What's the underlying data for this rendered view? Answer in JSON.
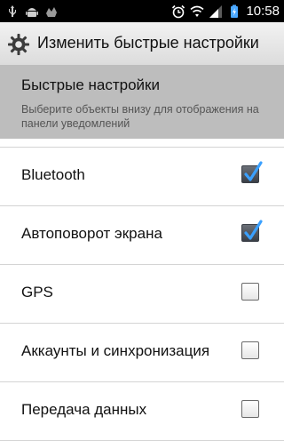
{
  "status_bar": {
    "time": "10:58",
    "left_icons": [
      "usb-icon",
      "android-icon",
      "debug-icon"
    ],
    "right_icons": [
      "alarm-icon",
      "wifi-icon",
      "signal-icon",
      "battery-icon"
    ]
  },
  "titlebar": {
    "icon": "gear-icon",
    "title": "Изменить быстрые настройки"
  },
  "header": {
    "title": "Быстрые настройки",
    "description": "Выберите объекты внизу для отображения на панели уведомлений"
  },
  "items": [
    {
      "label": "Bluetooth",
      "checked": true
    },
    {
      "label": "Автоповорот экрана",
      "checked": true
    },
    {
      "label": "GPS",
      "checked": false
    },
    {
      "label": "Аккаунты и синхронизация",
      "checked": false
    },
    {
      "label": "Передача данных",
      "checked": false
    }
  ],
  "colors": {
    "status_bar": "#000000",
    "header_bg": "#bdbdbd",
    "check_accent": "#3aa0ff"
  }
}
